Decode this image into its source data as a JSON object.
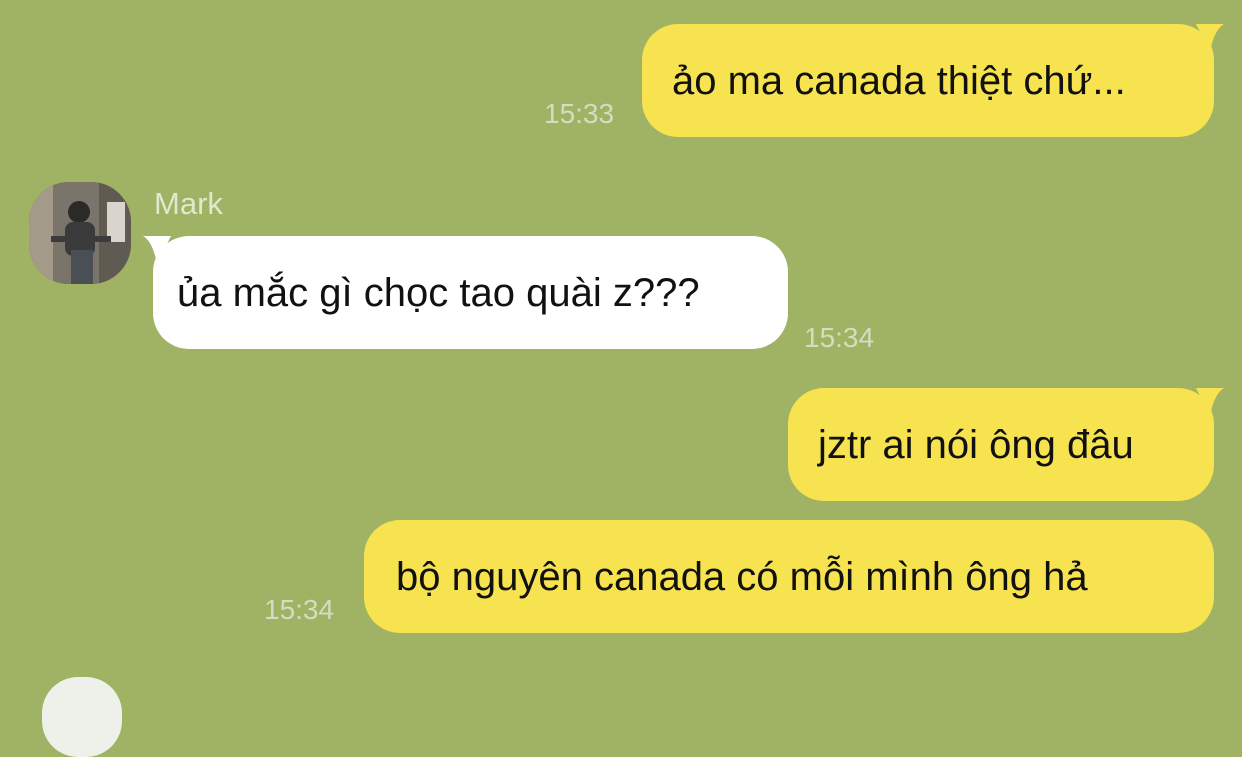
{
  "contact": {
    "name": "Mark"
  },
  "messages": [
    {
      "direction": "out",
      "text": "ảo ma canada thiệt chứ...",
      "time": "15:33"
    },
    {
      "direction": "in",
      "text": "ủa mắc gì chọc tao quài z???",
      "time": "15:34"
    },
    {
      "direction": "out",
      "text": "jztr ai nói ông đâu",
      "time": ""
    },
    {
      "direction": "out",
      "text": "bộ nguyên canada có mỗi mình ông hả",
      "time": "15:34"
    }
  ],
  "colors": {
    "background": "#a0b263",
    "outgoing_bubble": "#f7e34f",
    "incoming_bubble": "#ffffff"
  }
}
